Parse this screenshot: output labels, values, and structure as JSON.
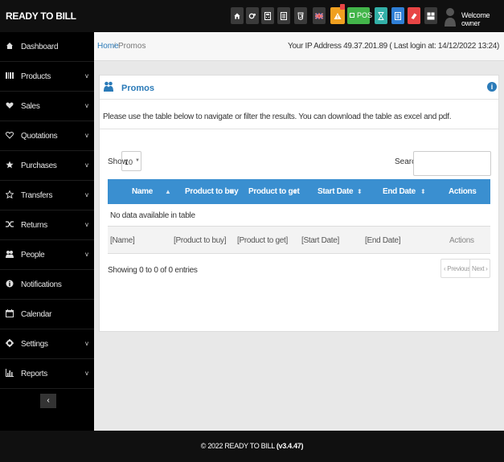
{
  "app": {
    "brand": "READY TO BILL",
    "welcome": "Welcome owner"
  },
  "toolbar": {
    "buttons": [
      {
        "icon": "home-icon",
        "color": "#3a3a3a"
      },
      {
        "icon": "cogs-icon",
        "color": "#3a3a3a"
      },
      {
        "icon": "calculator-icon",
        "color": "#3a3a3a"
      },
      {
        "icon": "list-icon",
        "color": "#3a3a3a"
      },
      {
        "icon": "html5-icon",
        "color": "#3a3a3a"
      },
      {
        "icon": "flag-uk-icon",
        "color": "#3a3a3a"
      },
      {
        "icon": "alert-triangle-icon",
        "color": "#f0a020"
      },
      {
        "icon": "pos-icon",
        "label": "POS",
        "color": "#43b54a"
      },
      {
        "icon": "hourglass-icon",
        "color": "#33b0a8"
      },
      {
        "icon": "list-alt-icon",
        "color": "#2f7fd6"
      },
      {
        "icon": "eraser-icon",
        "color": "#e84545"
      },
      {
        "icon": "dashboard-icon",
        "color": "#3a3a3a"
      }
    ]
  },
  "sidebar": {
    "items": [
      {
        "label": "Dashboard",
        "icon": "dashboard-icon",
        "has_submenu": false
      },
      {
        "label": "Products",
        "icon": "barcode-icon",
        "has_submenu": true
      },
      {
        "label": "Sales",
        "icon": "heart-icon",
        "has_submenu": true
      },
      {
        "label": "Quotations",
        "icon": "heart-outline-icon",
        "has_submenu": true
      },
      {
        "label": "Purchases",
        "icon": "star-icon",
        "has_submenu": true
      },
      {
        "label": "Transfers",
        "icon": "star-outline-icon",
        "has_submenu": true
      },
      {
        "label": "Returns",
        "icon": "random-icon",
        "has_submenu": true
      },
      {
        "label": "People",
        "icon": "users-icon",
        "has_submenu": true
      },
      {
        "label": "Notifications",
        "icon": "info-icon",
        "has_submenu": false
      },
      {
        "label": "Calendar",
        "icon": "calendar-icon",
        "has_submenu": false
      },
      {
        "label": "Settings",
        "icon": "cog-icon",
        "has_submenu": true
      },
      {
        "label": "Reports",
        "icon": "bar-chart-icon",
        "has_submenu": true
      }
    ],
    "chevron": "v",
    "collapse": "‹"
  },
  "breadcrumb": {
    "home": "Home",
    "sep": "/",
    "current": "Promos"
  },
  "ip_info": "Your IP Address 49.37.201.89 ( Last login at: 14/12/2022 13:24)",
  "panel": {
    "title": "Promos",
    "info_glyph": "i",
    "intro": "Please use the table below to navigate or filter the results. You can download the table as excel and pdf."
  },
  "table": {
    "show_label": "Show",
    "page_size": "10",
    "search_label": "Search",
    "search_value": "",
    "columns": [
      "Name",
      "Product to buy",
      "Product to get",
      "Start Date",
      "End Date",
      "Actions"
    ],
    "empty_text": "No data available in table",
    "filters": [
      "[Name]",
      "[Product to buy]",
      "[Product to get]",
      "[Start Date]",
      "[End Date]",
      "Actions"
    ],
    "entries_text": "Showing 0 to 0 of 0 entries",
    "prev_label": "‹ Previous",
    "next_label": "Next ›"
  },
  "footer": {
    "copyright": "© 2022 READY TO BILL",
    "version": "(v3.4.47)"
  }
}
